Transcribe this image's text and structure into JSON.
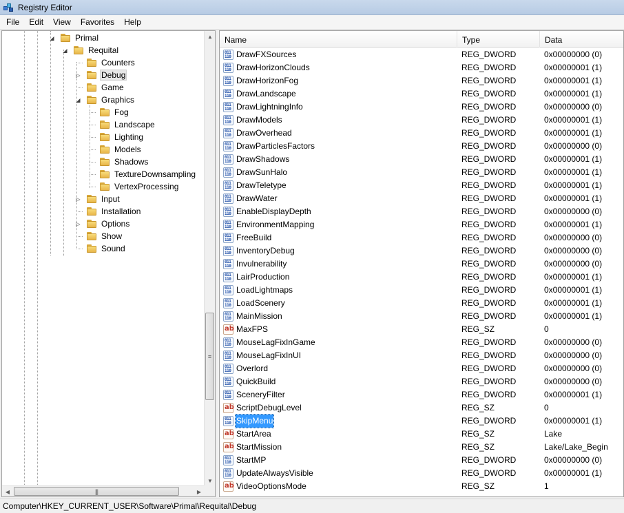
{
  "window": {
    "title": "Registry Editor"
  },
  "menu": [
    "File",
    "Edit",
    "View",
    "Favorites",
    "Help"
  ],
  "tree": [
    {
      "label": "Primal",
      "depth": 0,
      "expander": "open",
      "selected": false
    },
    {
      "label": "Requital",
      "depth": 1,
      "expander": "open",
      "selected": false
    },
    {
      "label": "Counters",
      "depth": 2,
      "expander": "none",
      "selected": false
    },
    {
      "label": "Debug",
      "depth": 2,
      "expander": "closed",
      "selected": true
    },
    {
      "label": "Game",
      "depth": 2,
      "expander": "none",
      "selected": false
    },
    {
      "label": "Graphics",
      "depth": 2,
      "expander": "open",
      "selected": false
    },
    {
      "label": "Fog",
      "depth": 3,
      "expander": "none",
      "selected": false
    },
    {
      "label": "Landscape",
      "depth": 3,
      "expander": "none",
      "selected": false
    },
    {
      "label": "Lighting",
      "depth": 3,
      "expander": "none",
      "selected": false
    },
    {
      "label": "Models",
      "depth": 3,
      "expander": "none",
      "selected": false
    },
    {
      "label": "Shadows",
      "depth": 3,
      "expander": "none",
      "selected": false
    },
    {
      "label": "TextureDownsampling",
      "depth": 3,
      "expander": "none",
      "selected": false
    },
    {
      "label": "VertexProcessing",
      "depth": 3,
      "expander": "none",
      "selected": false
    },
    {
      "label": "Input",
      "depth": 2,
      "expander": "closed",
      "selected": false
    },
    {
      "label": "Installation",
      "depth": 2,
      "expander": "none",
      "selected": false
    },
    {
      "label": "Options",
      "depth": 2,
      "expander": "closed",
      "selected": false
    },
    {
      "label": "Show",
      "depth": 2,
      "expander": "none",
      "selected": false
    },
    {
      "label": "Sound",
      "depth": 2,
      "expander": "none",
      "selected": false
    }
  ],
  "columns": {
    "name": "Name",
    "type": "Type",
    "data": "Data"
  },
  "values": [
    {
      "name": "DrawFXSources",
      "type": "REG_DWORD",
      "data": "0x00000000 (0)",
      "kind": "dword",
      "selected": false
    },
    {
      "name": "DrawHorizonClouds",
      "type": "REG_DWORD",
      "data": "0x00000001 (1)",
      "kind": "dword",
      "selected": false
    },
    {
      "name": "DrawHorizonFog",
      "type": "REG_DWORD",
      "data": "0x00000001 (1)",
      "kind": "dword",
      "selected": false
    },
    {
      "name": "DrawLandscape",
      "type": "REG_DWORD",
      "data": "0x00000001 (1)",
      "kind": "dword",
      "selected": false
    },
    {
      "name": "DrawLightningInfo",
      "type": "REG_DWORD",
      "data": "0x00000000 (0)",
      "kind": "dword",
      "selected": false
    },
    {
      "name": "DrawModels",
      "type": "REG_DWORD",
      "data": "0x00000001 (1)",
      "kind": "dword",
      "selected": false
    },
    {
      "name": "DrawOverhead",
      "type": "REG_DWORD",
      "data": "0x00000001 (1)",
      "kind": "dword",
      "selected": false
    },
    {
      "name": "DrawParticlesFactors",
      "type": "REG_DWORD",
      "data": "0x00000000 (0)",
      "kind": "dword",
      "selected": false
    },
    {
      "name": "DrawShadows",
      "type": "REG_DWORD",
      "data": "0x00000001 (1)",
      "kind": "dword",
      "selected": false
    },
    {
      "name": "DrawSunHalo",
      "type": "REG_DWORD",
      "data": "0x00000001 (1)",
      "kind": "dword",
      "selected": false
    },
    {
      "name": "DrawTeletype",
      "type": "REG_DWORD",
      "data": "0x00000001 (1)",
      "kind": "dword",
      "selected": false
    },
    {
      "name": "DrawWater",
      "type": "REG_DWORD",
      "data": "0x00000001 (1)",
      "kind": "dword",
      "selected": false
    },
    {
      "name": "EnableDisplayDepth",
      "type": "REG_DWORD",
      "data": "0x00000000 (0)",
      "kind": "dword",
      "selected": false
    },
    {
      "name": "EnvironmentMapping",
      "type": "REG_DWORD",
      "data": "0x00000001 (1)",
      "kind": "dword",
      "selected": false
    },
    {
      "name": "FreeBuild",
      "type": "REG_DWORD",
      "data": "0x00000000 (0)",
      "kind": "dword",
      "selected": false
    },
    {
      "name": "InventoryDebug",
      "type": "REG_DWORD",
      "data": "0x00000000 (0)",
      "kind": "dword",
      "selected": false
    },
    {
      "name": "Invulnerability",
      "type": "REG_DWORD",
      "data": "0x00000000 (0)",
      "kind": "dword",
      "selected": false
    },
    {
      "name": "LairProduction",
      "type": "REG_DWORD",
      "data": "0x00000001 (1)",
      "kind": "dword",
      "selected": false
    },
    {
      "name": "LoadLightmaps",
      "type": "REG_DWORD",
      "data": "0x00000001 (1)",
      "kind": "dword",
      "selected": false
    },
    {
      "name": "LoadScenery",
      "type": "REG_DWORD",
      "data": "0x00000001 (1)",
      "kind": "dword",
      "selected": false
    },
    {
      "name": "MainMission",
      "type": "REG_DWORD",
      "data": "0x00000001 (1)",
      "kind": "dword",
      "selected": false
    },
    {
      "name": "MaxFPS",
      "type": "REG_SZ",
      "data": "0",
      "kind": "string",
      "selected": false
    },
    {
      "name": "MouseLagFixInGame",
      "type": "REG_DWORD",
      "data": "0x00000000 (0)",
      "kind": "dword",
      "selected": false
    },
    {
      "name": "MouseLagFixInUI",
      "type": "REG_DWORD",
      "data": "0x00000000 (0)",
      "kind": "dword",
      "selected": false
    },
    {
      "name": "Overlord",
      "type": "REG_DWORD",
      "data": "0x00000000 (0)",
      "kind": "dword",
      "selected": false
    },
    {
      "name": "QuickBuild",
      "type": "REG_DWORD",
      "data": "0x00000000 (0)",
      "kind": "dword",
      "selected": false
    },
    {
      "name": "SceneryFilter",
      "type": "REG_DWORD",
      "data": "0x00000001 (1)",
      "kind": "dword",
      "selected": false
    },
    {
      "name": "ScriptDebugLevel",
      "type": "REG_SZ",
      "data": "0",
      "kind": "string",
      "selected": false
    },
    {
      "name": "SkipMenu",
      "type": "REG_DWORD",
      "data": "0x00000001 (1)",
      "kind": "dword",
      "selected": true
    },
    {
      "name": "StartArea",
      "type": "REG_SZ",
      "data": "Lake",
      "kind": "string",
      "selected": false
    },
    {
      "name": "StartMission",
      "type": "REG_SZ",
      "data": "Lake/Lake_Begin",
      "kind": "string",
      "selected": false
    },
    {
      "name": "StartMP",
      "type": "REG_DWORD",
      "data": "0x00000000 (0)",
      "kind": "dword",
      "selected": false
    },
    {
      "name": "UpdateAlwaysVisible",
      "type": "REG_DWORD",
      "data": "0x00000001 (1)",
      "kind": "dword",
      "selected": false
    },
    {
      "name": "VideoOptionsMode",
      "type": "REG_SZ",
      "data": "1",
      "kind": "string",
      "selected": false
    }
  ],
  "status": {
    "path": "Computer\\HKEY_CURRENT_USER\\Software\\Primal\\Requital\\Debug"
  },
  "colors": {
    "selection": "#3399ff",
    "titlebar": "#c9d9ec",
    "folder": "#f8dc7a"
  }
}
